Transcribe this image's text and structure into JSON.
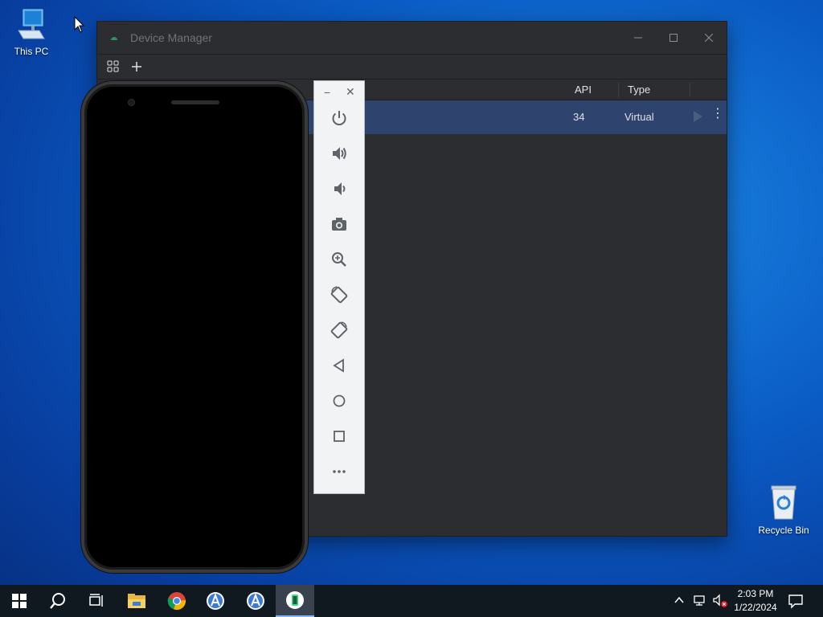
{
  "desktop": {
    "this_pc_label": "This PC",
    "recycle_bin_label": "Recycle Bin"
  },
  "device_manager": {
    "title": "Device Manager",
    "columns": {
      "api": "API",
      "type": "Type"
    },
    "row": {
      "api": "34",
      "type": "Virtual"
    }
  },
  "taskbar": {
    "time": "2:03 PM",
    "date": "1/22/2024"
  },
  "colors": {
    "dm_background": "#2b2d30",
    "dm_selected_row": "#2e436e",
    "emulator_toolbar": "#f2f3f5",
    "taskbar": "#101820"
  },
  "icons": [
    "this-pc-icon",
    "recycle-bin-icon",
    "power-icon",
    "volume-up-icon",
    "volume-down-icon",
    "camera-icon",
    "zoom-icon",
    "rotate-left-icon",
    "rotate-right-icon",
    "back-icon",
    "home-icon",
    "overview-icon",
    "more-icon",
    "start-icon",
    "search-icon",
    "task-view-icon",
    "file-explorer-icon",
    "chrome-icon",
    "android-studio-icon",
    "emulator-icon",
    "notification-icon"
  ]
}
